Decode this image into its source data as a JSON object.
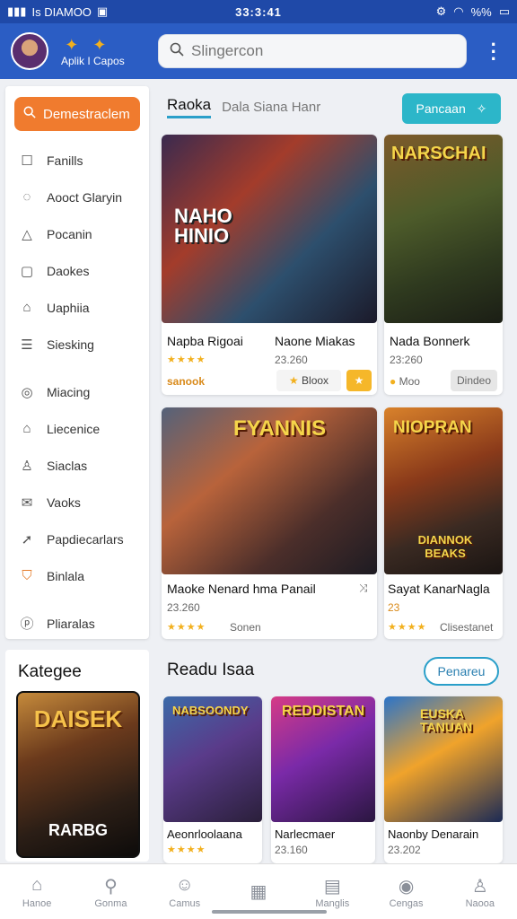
{
  "status_bar": {
    "left": "Is DIAMOO",
    "time": "33:3:41",
    "battery": "%%"
  },
  "app": {
    "name": "Aplik I Capos"
  },
  "search": {
    "placeholder": "Slingercon",
    "value": ""
  },
  "sidebar": {
    "primary_button": "Demestraclem",
    "items": [
      {
        "label": "Fanills",
        "icon": "square-icon"
      },
      {
        "label": "Aooct Glaryin",
        "icon": "chat-icon"
      },
      {
        "label": "Pocanin",
        "icon": "bell-icon"
      },
      {
        "label": "Daokes",
        "icon": "box-icon"
      },
      {
        "label": "Uaphiia",
        "icon": "home-icon"
      },
      {
        "label": "Siesking",
        "icon": "list-icon"
      },
      {
        "label": "Miacing",
        "icon": "circle-icon"
      },
      {
        "label": "Liecenice",
        "icon": "store-icon"
      },
      {
        "label": "Siaclas",
        "icon": "user-icon"
      },
      {
        "label": "Vaoks",
        "icon": "mail-icon"
      },
      {
        "label": "Papdiecarlars",
        "icon": "arrow-icon"
      },
      {
        "label": "Binlala",
        "icon": "bag-icon"
      },
      {
        "label": "Pliaralas",
        "icon": "p-circle-icon"
      }
    ]
  },
  "categories": {
    "title": "Kategee",
    "card_title": "DAISEK",
    "card_subtitle": "RARBG"
  },
  "main": {
    "tab_active": "Raoka",
    "tab_other": "Dala Siana Hanr",
    "action_button": "Pancaan",
    "section_title": "Readu Isaa",
    "section_button": "Penareu"
  },
  "cards": [
    {
      "art_title": "NAHO HINIO",
      "title_a": "Napba Rigoai",
      "title_b": "Naone Miakas",
      "rating": "★★★★",
      "tag": "sanook",
      "count": "23.260",
      "sub": "Bloox"
    },
    {
      "art_title": "NARSCHAI",
      "title": "Nada Bonnerk",
      "count": "23:260",
      "sub": "Moo",
      "pill": "Dindeo"
    },
    {
      "art_title": "FYANNIS",
      "title": "Maoke Nenard hma Panail",
      "count": "23.260",
      "sub": "Sonen",
      "rating": "★★★★"
    },
    {
      "art_title": "NIOPRAN",
      "art_sub": "DIANNOK BEAKS",
      "title": "Sayat KanarNagla",
      "count": "23",
      "rating": "★★★★",
      "sub": "Clisestanet"
    },
    {
      "art_title": "NABSOONDY",
      "title": "Aeonrloolaana",
      "rating": "★★★★"
    },
    {
      "art_title": "REDDISTAN",
      "title": "Narlecmaer",
      "count": "23.160"
    },
    {
      "art_title": "EUSKA TANUAN",
      "title": "Naonby Denarain",
      "count": "23.202"
    }
  ],
  "bottom_nav": [
    "Hanoe",
    "Gonma",
    "Camus",
    "",
    "Manglis",
    "Cengas",
    "Naooa"
  ]
}
